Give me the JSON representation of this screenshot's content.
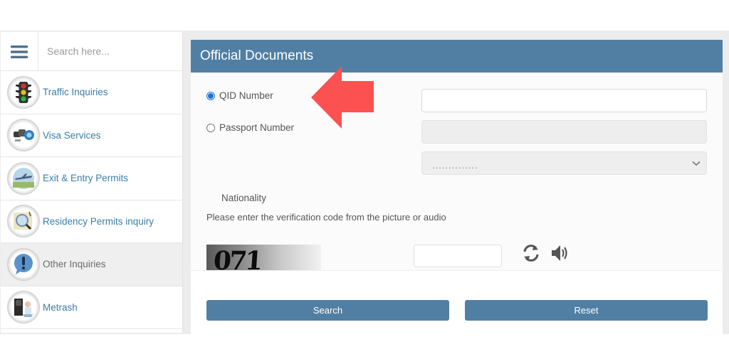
{
  "sidebar": {
    "menu_icon": "hamburger-menu-icon",
    "search_placeholder": "Search here...",
    "items": [
      {
        "label": "Traffic Inquiries",
        "icon": "traffic-light-icon",
        "active": false
      },
      {
        "label": "Visa Services",
        "icon": "visa-services-icon",
        "active": false
      },
      {
        "label": "Exit & Entry Permits",
        "icon": "airplane-icon",
        "active": false
      },
      {
        "label": "Residency Permits inquiry",
        "icon": "magnifier-document-icon",
        "active": false
      },
      {
        "label": "Other Inquiries",
        "icon": "exclamation-bubble-icon",
        "active": true
      },
      {
        "label": "Metrash",
        "icon": "metrash-kiosk-icon",
        "active": false
      }
    ]
  },
  "panel": {
    "title": "Official Documents",
    "options": [
      {
        "label": "QID Number",
        "checked": true
      },
      {
        "label": "Passport Number",
        "checked": false
      }
    ],
    "qid_value": "",
    "passport_value": "",
    "nationality_label": "Nationality",
    "nationality_selected": "..............",
    "verification_hint": "Please enter the verification code from the picture or audio",
    "captcha_text": "071",
    "captcha_value": "",
    "search_label": "Search",
    "reset_label": "Reset"
  },
  "annotation": {
    "type": "arrow-left",
    "color": "#fb5150",
    "target": "QID Number"
  },
  "colors": {
    "accent": "#517fa3",
    "link": "#3a7ea7",
    "radio_checked": "#1e73d8"
  }
}
